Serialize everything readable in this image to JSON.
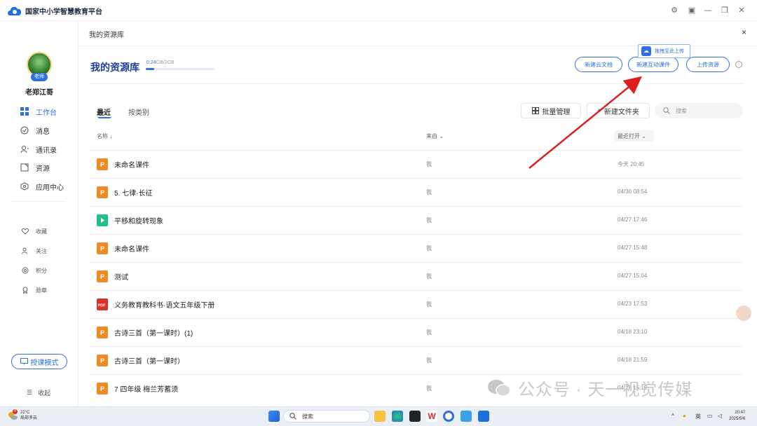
{
  "app": {
    "title": "国家中小学智慧教育平台"
  },
  "sidebar": {
    "username": "老郑江哥",
    "role_badge": "老师",
    "nav": [
      {
        "label": "工作台",
        "icon": "grid-icon",
        "active": true
      },
      {
        "label": "消息",
        "icon": "message-icon"
      },
      {
        "label": "通讯录",
        "icon": "contacts-icon"
      },
      {
        "label": "资源",
        "icon": "resource-icon"
      },
      {
        "label": "应用中心",
        "icon": "app-center-icon"
      }
    ],
    "nav_secondary": [
      {
        "label": "收藏",
        "icon": "heart-icon"
      },
      {
        "label": "关注",
        "icon": "follow-icon"
      },
      {
        "label": "积分",
        "icon": "points-icon"
      },
      {
        "label": "勋章",
        "icon": "medal-icon"
      }
    ],
    "teach_mode": "授课模式",
    "collapse": "收起"
  },
  "main": {
    "breadcrumb": "我的资源库",
    "close": "×",
    "title": "我的资源库",
    "storage_used": "0.24",
    "storage_rest": "GB/2GB",
    "storage_fraction": 0.12,
    "buttons": {
      "new_doc": "新建云文档",
      "new_interactive": "新建互动课件",
      "upload": "上传资源"
    },
    "tooltip": "拖拽至此上传",
    "tabs": {
      "recent": "最近",
      "by_type": "按类别"
    },
    "batch": "批量管理",
    "new_folder": "新建文件夹",
    "search_placeholder": "搜索",
    "columns": {
      "name": "名称",
      "from": "来自",
      "opened": "最近打开"
    },
    "rows": [
      {
        "name": "未命名课件",
        "type": "ppt",
        "from": "我",
        "time": "今天 20:45"
      },
      {
        "name": "5. 七律·长征",
        "type": "ppt",
        "from": "我",
        "time": "04/30 08:54"
      },
      {
        "name": "平移和旋转现象",
        "type": "video",
        "from": "我",
        "time": "04/27 17:46"
      },
      {
        "name": "未命名课件",
        "type": "ppt",
        "from": "我",
        "time": "04/27 15:48"
      },
      {
        "name": "测试",
        "type": "ppt",
        "from": "我",
        "time": "04/27 15:04"
      },
      {
        "name": "义务教育教科书·语文五年级下册",
        "type": "pdf",
        "from": "我",
        "time": "04/23 17:53"
      },
      {
        "name": "古诗三首（第一课时）(1)",
        "type": "ppt",
        "from": "我",
        "time": "04/18 23:10"
      },
      {
        "name": "古诗三首（第一课时）",
        "type": "ppt",
        "from": "我",
        "time": "04/18 21:59"
      },
      {
        "name": "7 四年级 梅兰芳蓄须",
        "type": "ppt",
        "from": "我",
        "time": "04/18 15:19"
      }
    ]
  },
  "watermark": "公众号 · 天一视觉传媒",
  "taskbar": {
    "weather_temp": "22°C",
    "weather_desc": "局部多云",
    "weather_badge": "4",
    "search": "搜索",
    "ime": "英",
    "time": "20:47",
    "date": "2025/5/6"
  },
  "colors": {
    "accent": "#2f6fe4",
    "ppt": "#f08a24",
    "pdf": "#d9302c",
    "video": "#21c08b"
  }
}
